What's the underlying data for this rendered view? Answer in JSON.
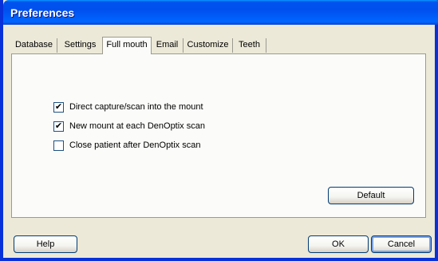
{
  "window": {
    "title": "Preferences"
  },
  "tabs": [
    {
      "label": "Database",
      "selected": false
    },
    {
      "label": "Settings",
      "selected": false
    },
    {
      "label": "Full mouth",
      "selected": true
    },
    {
      "label": "Email",
      "selected": false
    },
    {
      "label": "Customize",
      "selected": false
    },
    {
      "label": "Teeth",
      "selected": false
    }
  ],
  "options": [
    {
      "label": "Direct capture/scan into the mount",
      "checked": true
    },
    {
      "label": "New mount at each DenOptix scan",
      "checked": true
    },
    {
      "label": "Close patient after DenOptix scan",
      "checked": false
    }
  ],
  "panel": {
    "default_label": "Default"
  },
  "footer": {
    "help_label": "Help",
    "ok_label": "OK",
    "cancel_label": "Cancel"
  }
}
